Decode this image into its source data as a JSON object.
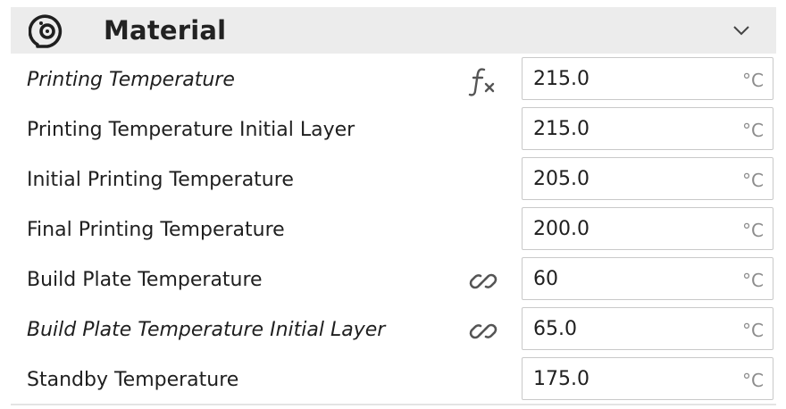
{
  "section": {
    "title": "Material",
    "icon": "spool-icon",
    "chevron": "chevron-down-icon"
  },
  "settings": [
    {
      "label": "Printing Temperature",
      "italic": true,
      "icon": "function-icon",
      "value": "215.0",
      "unit": "°C"
    },
    {
      "label": "Printing Temperature Initial Layer",
      "italic": false,
      "icon": "",
      "value": "215.0",
      "unit": "°C"
    },
    {
      "label": "Initial Printing Temperature",
      "italic": false,
      "icon": "",
      "value": "205.0",
      "unit": "°C"
    },
    {
      "label": "Final Printing Temperature",
      "italic": false,
      "icon": "",
      "value": "200.0",
      "unit": "°C"
    },
    {
      "label": "Build Plate Temperature",
      "italic": false,
      "icon": "link-icon",
      "value": "60",
      "unit": "°C"
    },
    {
      "label": "Build Plate Temperature Initial Layer",
      "italic": true,
      "icon": "link-icon",
      "value": "65.0",
      "unit": "°C"
    },
    {
      "label": "Standby Temperature",
      "italic": false,
      "icon": "",
      "value": "175.0",
      "unit": "°C"
    }
  ]
}
